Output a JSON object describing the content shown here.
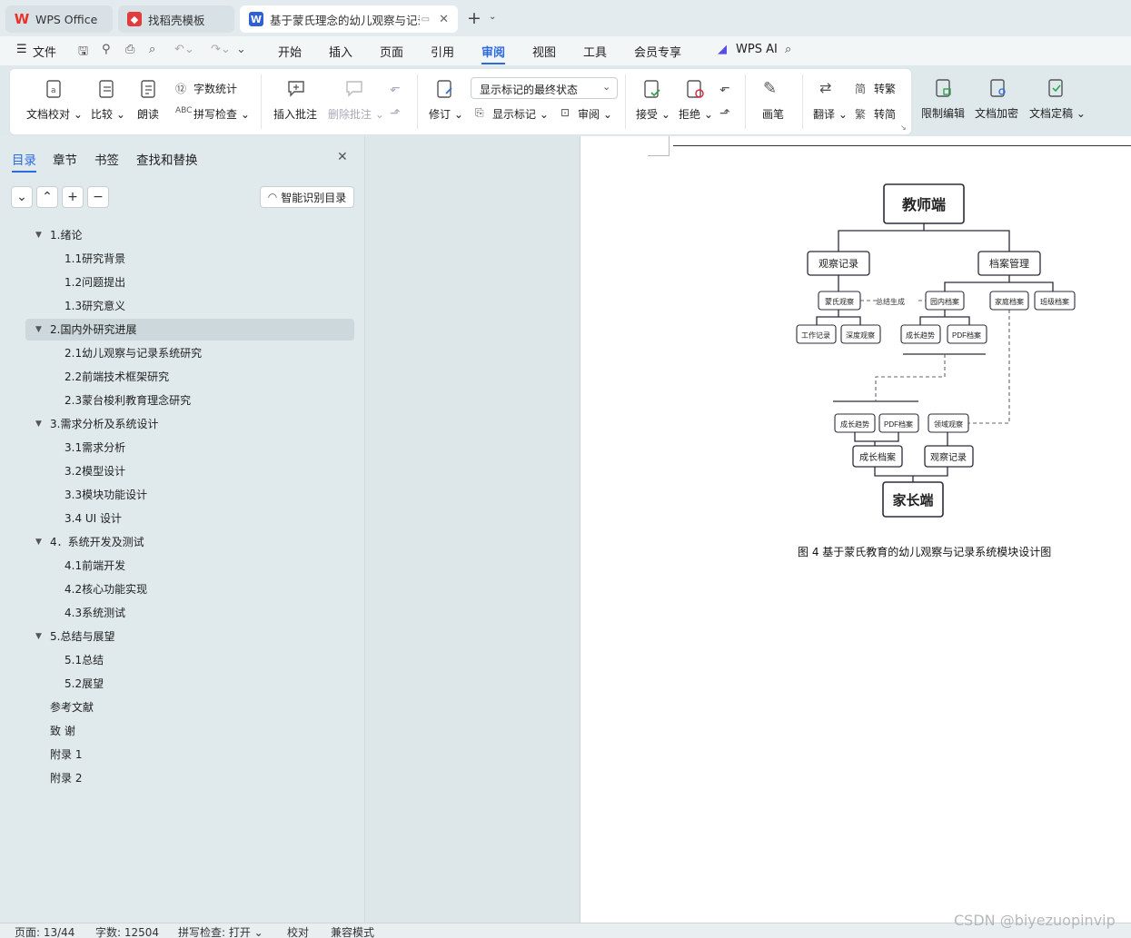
{
  "tabs": [
    {
      "label": "WPS Office",
      "icon": "wps-logo"
    },
    {
      "label": "找稻壳模板",
      "icon": "docer-logo"
    },
    {
      "label": "基于蒙氏理念的幼儿观察与记录",
      "icon": "word-doc",
      "badge": "W"
    }
  ],
  "menu": {
    "file": "文件",
    "items": [
      "开始",
      "插入",
      "页面",
      "引用",
      "审阅",
      "视图",
      "工具",
      "会员专享"
    ],
    "active": "审阅",
    "ai": "WPS AI"
  },
  "ribbon": {
    "doc_check": "文档校对",
    "compare": "比较",
    "read_aloud": "朗读",
    "word_count": "字数统计",
    "spell_check": "拼写检查",
    "insert_comment": "插入批注",
    "delete_comment": "删除批注",
    "track": "修订",
    "markup_select": "显示标记的最终状态",
    "show_markup": "显示标记",
    "review": "审阅",
    "accept": "接受",
    "reject": "拒绝",
    "pen": "画笔",
    "translate": "翻译",
    "to_traditional": "转繁",
    "to_simplified": "转简",
    "restrict": "限制编辑",
    "encrypt": "文档加密",
    "finalize": "文档定稿"
  },
  "sidebar": {
    "tabs": [
      "目录",
      "章节",
      "书签",
      "查找和替换"
    ],
    "smart_btn": "智能识别目录",
    "toc": [
      {
        "text": "1.绪论",
        "level": 1
      },
      {
        "text": "1.1研究背景",
        "level": 2
      },
      {
        "text": "1.2问题提出",
        "level": 2
      },
      {
        "text": "1.3研究意义",
        "level": 2
      },
      {
        "text": "2.国内外研究进展",
        "level": 1
      },
      {
        "text": "2.1幼儿观察与记录系统研究",
        "level": 2
      },
      {
        "text": "2.2前端技术框架研究",
        "level": 2
      },
      {
        "text": "2.3蒙台梭利教育理念研究",
        "level": 2
      },
      {
        "text": "3.需求分析及系统设计",
        "level": 1
      },
      {
        "text": "3.1需求分析",
        "level": 2
      },
      {
        "text": "3.2模型设计",
        "level": 2
      },
      {
        "text": "3.3模块功能设计",
        "level": 2
      },
      {
        "text": "3.4 UI 设计",
        "level": 2
      },
      {
        "text": "4．系统开发及测试",
        "level": 1
      },
      {
        "text": "4.1前端开发",
        "level": 2
      },
      {
        "text": "4.2核心功能实现",
        "level": 2
      },
      {
        "text": "4.3系统测试",
        "level": 2
      },
      {
        "text": "5.总结与展望",
        "level": 1
      },
      {
        "text": "5.1总结",
        "level": 2
      },
      {
        "text": "5.2展望",
        "level": 2
      },
      {
        "text": "参考文献",
        "level": 0
      },
      {
        "text": "致 谢",
        "level": 0
      },
      {
        "text": "附录 1",
        "level": 0
      },
      {
        "text": "附录 2",
        "level": 0
      }
    ]
  },
  "diagram": {
    "teacher": "教师端",
    "parent": "家长端",
    "obs_record": "观察记录",
    "archive_mgmt": "档案管理",
    "montessori_obs": "蒙氏观察",
    "summary_gen": "总结生成",
    "kindergarten_archive": "园内档案",
    "family_archive": "家庭档案",
    "class_archive": "班级档案",
    "work_record": "工作记录",
    "depth_obs": "深度观察",
    "growth_trend": "成长趋势",
    "pdf_archive": "PDF档案",
    "growth_trend2": "成长趋势",
    "pdf_archive2": "PDF档案",
    "domain_obs": "领域观察",
    "growth_archive": "成长档案",
    "obs_record2": "观察记录",
    "caption": "图 4 基于蒙氏教育的幼儿观察与记录系统模块设计图"
  },
  "status": {
    "page": "页面: 13/44",
    "words": "字数: 12504",
    "spell": "拼写检查: 打开",
    "proof": "校对",
    "compat": "兼容模式"
  },
  "watermark": "CSDN @biyezuopinvip",
  "colors": {
    "accent": "#2b6bdf",
    "selected_row": "#ccd8dc",
    "wps_red": "#e8322b",
    "docer_red": "#e23b3b",
    "word_blue": "#2f5fd6"
  }
}
